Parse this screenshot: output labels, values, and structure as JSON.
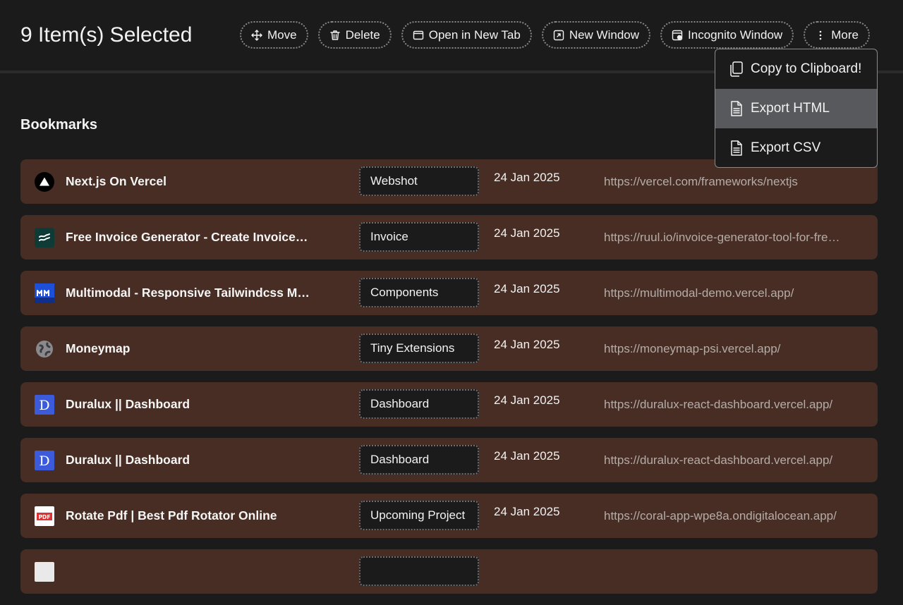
{
  "header": {
    "selected_count": "9 Item(s) Selected"
  },
  "actions": [
    {
      "label": "Move",
      "icon": "move-icon"
    },
    {
      "label": "Delete",
      "icon": "trash-icon"
    },
    {
      "label": "Open in New Tab",
      "icon": "tab-icon"
    },
    {
      "label": "New Window",
      "icon": "new-window-icon"
    },
    {
      "label": "Incognito Window",
      "icon": "incognito-icon"
    },
    {
      "label": "More",
      "icon": "more-vertical-icon"
    }
  ],
  "dropdown": {
    "items": [
      {
        "label": "Copy to Clipboard!",
        "icon": "copy-icon",
        "active": false
      },
      {
        "label": "Export HTML",
        "icon": "file-icon",
        "active": true
      },
      {
        "label": "Export CSV",
        "icon": "file-icon",
        "active": false
      }
    ]
  },
  "bookmarks": {
    "title": "Bookmarks",
    "rows": [
      {
        "title": "Next.js On Vercel",
        "tag": "Webshot",
        "date": "24 Jan 2025",
        "url": "https://vercel.com/frameworks/nextjs",
        "icon": "vercel-icon"
      },
      {
        "title": "Free Invoice Generator - Create Invoices Online",
        "tag": "Invoice",
        "date": "24 Jan 2025",
        "url": "https://ruul.io/invoice-generator-tool-for-freelancers",
        "icon": "ruul-icon"
      },
      {
        "title": "Multimodal - Responsive Tailwindcss Modals",
        "tag": "Components",
        "date": "24 Jan 2025",
        "url": "https://multimodal-demo.vercel.app/",
        "icon": "multimodal-icon"
      },
      {
        "title": "Moneymap",
        "tag": "Tiny Extensions",
        "date": "24 Jan 2025",
        "url": "https://moneymap-psi.vercel.app/",
        "icon": "globe-icon"
      },
      {
        "title": "Duralux || Dashboard",
        "tag": "Dashboard",
        "date": "24 Jan 2025",
        "url": "https://duralux-react-dashboard.vercel.app/",
        "icon": "duralux-icon"
      },
      {
        "title": "Duralux || Dashboard",
        "tag": "Dashboard",
        "date": "24 Jan 2025",
        "url": "https://duralux-react-dashboard.vercel.app/",
        "icon": "duralux-icon"
      },
      {
        "title": "Rotate Pdf | Best Pdf Rotator Online",
        "tag": "Upcoming Project",
        "date": "24 Jan 2025",
        "url": "https://coral-app-wpe8a.ondigitalocean.app/",
        "icon": "pdf-icon"
      },
      {
        "title": "",
        "tag": "",
        "date": "",
        "url": "",
        "icon": "blank-icon"
      }
    ]
  },
  "colors": {
    "background": "#1b1b1c",
    "row": "#472d23",
    "url_text": "#b5aca8",
    "active_menu": "#57595c"
  }
}
